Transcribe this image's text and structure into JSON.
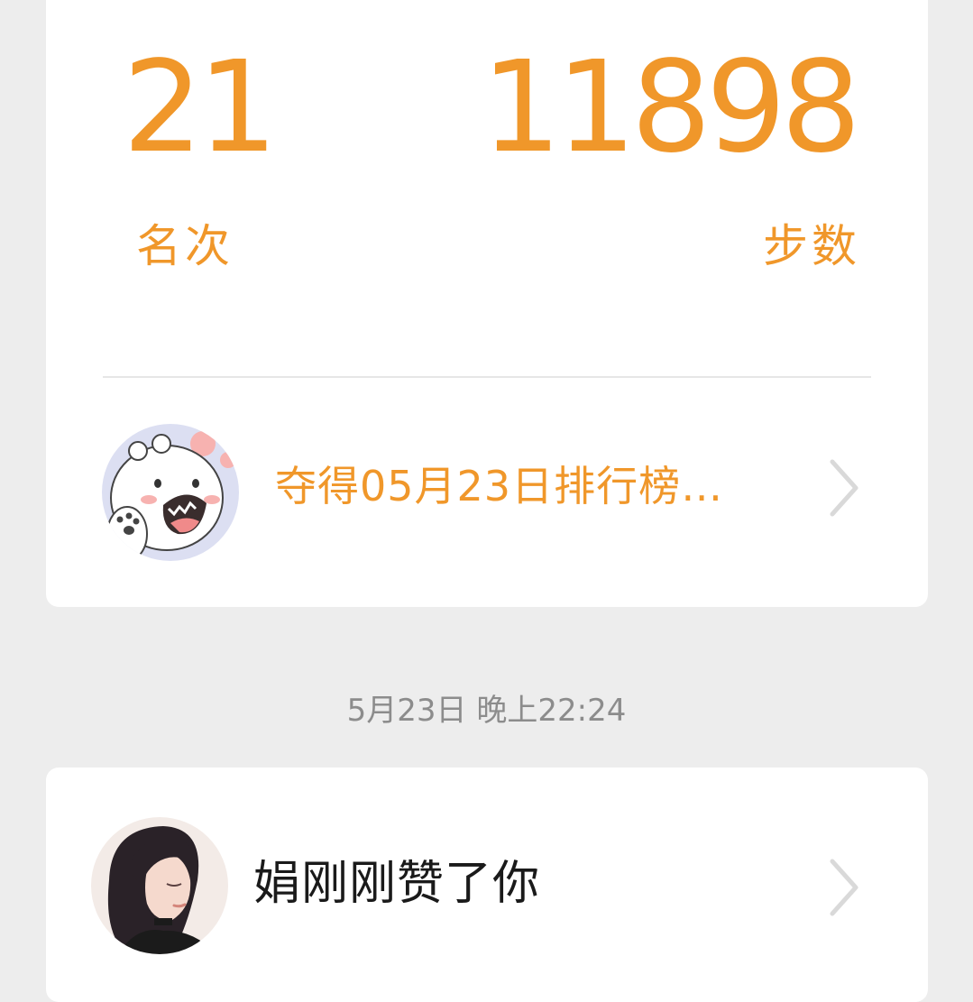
{
  "stats": {
    "rank_value": "21",
    "rank_label": "名次",
    "steps_value": "11898",
    "steps_label": "步数"
  },
  "champion": {
    "text": "夺得05月23日排行榜…",
    "avatar_icon": "polar-bear-avatar"
  },
  "timestamp": "5月23日 晚上22:24",
  "like": {
    "text": "娟刚刚赞了你",
    "avatar_icon": "girl-avatar"
  },
  "colors": {
    "accent": "#f0972a",
    "background": "#ededed",
    "card": "#ffffff",
    "muted_text": "#8c8c8c",
    "chevron": "#d9d9d9"
  }
}
